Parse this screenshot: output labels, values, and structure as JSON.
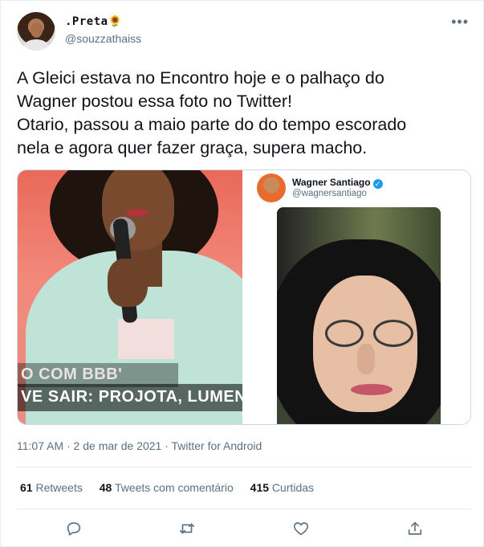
{
  "user": {
    "display_name": ".Preta",
    "display_emoji": "🌻",
    "handle": "@souzzathaiss"
  },
  "tweet": {
    "lines": [
      "A Gleici estava no Encontro hoje e o palhaço do",
      "Wagner postou essa foto no Twitter!",
      "Otario, passou a maio parte do do tempo escorado",
      "nela e agora quer fazer graça, supera macho."
    ]
  },
  "media": {
    "left_caption_1": "O COM BBB'",
    "left_caption_2": "VE SAIR: PROJOTA, LUMENA (",
    "embedded_name": "Wagner Santiago",
    "embedded_handle": "@wagnersantiago"
  },
  "meta": {
    "timestamp": "11:07 AM · 2 de mar de 2021 · Twitter for Android"
  },
  "stats": {
    "retweets_count": "61",
    "retweets_label": "Retweets",
    "quotes_count": "48",
    "quotes_label": "Tweets com comentário",
    "likes_count": "415",
    "likes_label": "Curtidas"
  },
  "icons": {
    "more": "more-horizontal-icon",
    "reply": "reply-icon",
    "retweet": "retweet-icon",
    "like": "heart-icon",
    "share": "share-icon",
    "verified": "verified-badge-icon"
  },
  "colors": {
    "text": "#0f1419",
    "secondary": "#5b7083",
    "verified": "#1d9bf0",
    "border": "#e6ecf0"
  }
}
